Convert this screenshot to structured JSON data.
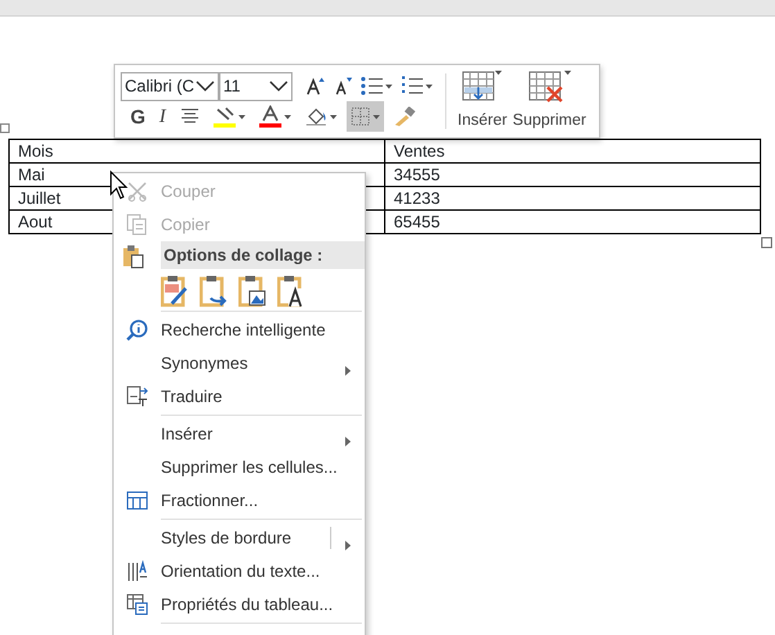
{
  "table": {
    "rows": [
      {
        "cells": [
          "Mois",
          "Ventes"
        ]
      },
      {
        "cells": [
          "Mai",
          "34555"
        ]
      },
      {
        "cells": [
          "Juillet",
          "41233"
        ]
      },
      {
        "cells": [
          "Aout",
          "65455"
        ]
      }
    ]
  },
  "mini_toolbar": {
    "font": {
      "value": "Calibri (C"
    },
    "size": {
      "value": "11"
    },
    "format_buttons": [
      {
        "kind": "text",
        "label": "G",
        "selected": false
      },
      {
        "kind": "text",
        "label": "I",
        "selected": false
      },
      {
        "kind": "align",
        "selected": false
      },
      {
        "kind": "highlight",
        "color": "#ffff00",
        "selected": false
      },
      {
        "kind": "fontcolor",
        "color": "#ff0000",
        "selected": false
      },
      {
        "kind": "shading",
        "selected": false
      },
      {
        "kind": "borders",
        "selected": true
      },
      {
        "kind": "painter",
        "selected": false
      }
    ],
    "table_buttons": [
      {
        "label": "Insérer"
      },
      {
        "label": "Supprimer"
      }
    ]
  },
  "context_menu": {
    "items": [
      {
        "kind": "item",
        "label": "Couper",
        "disabled": true,
        "submenu": false
      },
      {
        "kind": "item",
        "label": "Copier",
        "disabled": true,
        "submenu": false
      },
      {
        "kind": "header",
        "label": "Options de collage :"
      },
      {
        "kind": "paste"
      },
      {
        "kind": "separator"
      },
      {
        "kind": "item",
        "label": "Recherche intelligente",
        "disabled": false,
        "submenu": false
      },
      {
        "kind": "item",
        "label": "Synonymes",
        "disabled": false,
        "submenu": true
      },
      {
        "kind": "item",
        "label": "Traduire",
        "disabled": false,
        "submenu": false
      },
      {
        "kind": "separator"
      },
      {
        "kind": "item",
        "label": "Insérer",
        "disabled": false,
        "submenu": true
      },
      {
        "kind": "item",
        "label": "Supprimer les cellules...",
        "disabled": false,
        "submenu": false
      },
      {
        "kind": "item",
        "label": "Fractionner...",
        "disabled": false,
        "submenu": false
      },
      {
        "kind": "separator"
      },
      {
        "kind": "item",
        "label": "Styles de bordure",
        "disabled": false,
        "submenu": true,
        "split": true
      },
      {
        "kind": "item",
        "label": "Orientation du texte...",
        "disabled": false,
        "submenu": false
      },
      {
        "kind": "item",
        "label": "Propriétés du tableau...",
        "disabled": false,
        "submenu": false
      },
      {
        "kind": "separator"
      }
    ]
  }
}
